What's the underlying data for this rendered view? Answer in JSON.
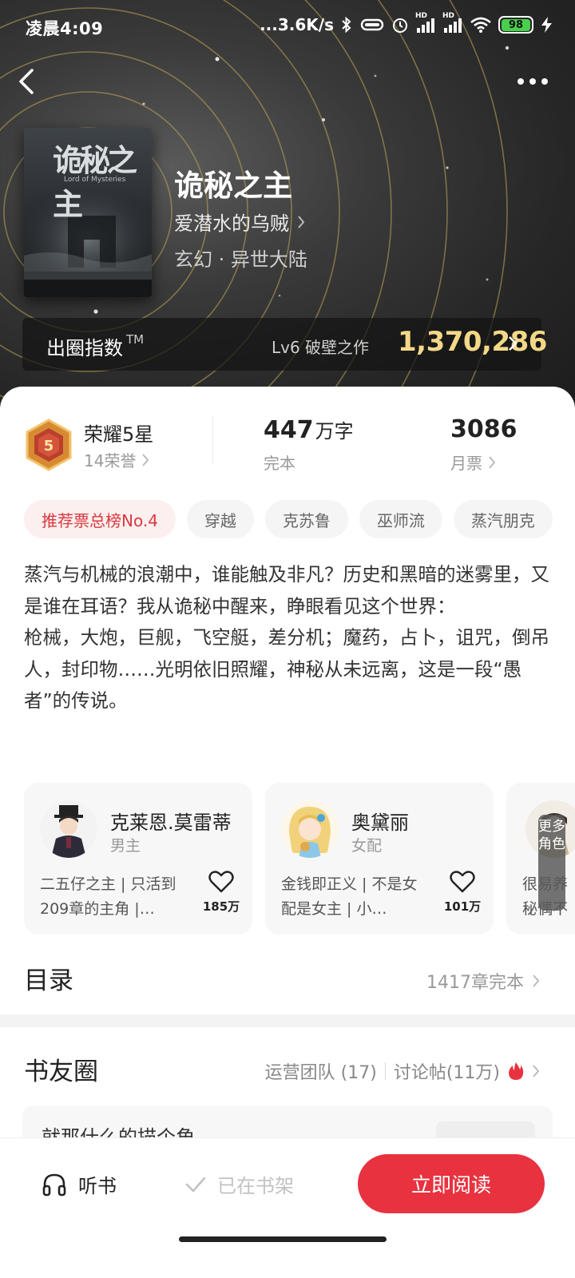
{
  "status_bar": {
    "time": "凌晨4:09",
    "network_speed": "...3.6K/s",
    "signal_label_1": "HD",
    "signal_label_2": "HD",
    "battery": "98"
  },
  "header": {
    "back_icon": "chevron-left-icon",
    "more_icon": "more-dots-icon"
  },
  "book": {
    "cover_title": "诡秘之主",
    "cover_subtitle": "Lord of Mysteries",
    "title": "诡秘之主",
    "author": "爱潜水的乌贼",
    "genre": "玄幻 · 异世大陆"
  },
  "chuquan": {
    "label": "出圈指数",
    "trademark": "TM",
    "level": "Lv6 破壁之作",
    "score": "1,370,286"
  },
  "stats": {
    "honor_title": "荣耀5星",
    "honor_count": "14荣誉",
    "medal_number": "5",
    "words_number": "447",
    "words_unit": "万字",
    "words_status": "完本",
    "votes_number": "3086",
    "votes_label": "月票"
  },
  "tags": [
    "推荐票总榜No.4",
    "穿越",
    "克苏鲁",
    "巫师流",
    "蒸汽朋克"
  ],
  "description": {
    "line1": "蒸汽与机械的浪潮中，谁能触及非凡？历史和黑暗的迷雾里，又是谁在耳语？我从诡秘中醒来，睁眼看见这个世界：",
    "line2": "枪械，大炮，巨舰，飞空艇，差分机；魔药，占卜，诅咒，倒吊人，封印物……光明依旧照耀，神秘从未远离，这是一段“愚者”的传说。"
  },
  "characters": [
    {
      "name": "克莱恩.莫雷蒂",
      "role": "男主",
      "desc": "二五仔之主 | 只活到209章的主角 |…",
      "likes": "185万"
    },
    {
      "name": "奥黛丽",
      "role": "女配",
      "desc": "金钱即正义 | 不是女配是女主 | 小…",
      "likes": "101万"
    }
  ],
  "more_roles": {
    "label": "更多角色",
    "peek_line1": "很易养",
    "peek_line2": "秘偶不"
  },
  "toc": {
    "title": "目录",
    "info": "1417章完本"
  },
  "book_circle": {
    "title": "书友圈",
    "team": "运营团队 (17)",
    "posts": "讨论帖(11万)",
    "post_preview": "就那什么的描个角"
  },
  "bottom_bar": {
    "listen_label": "听书",
    "shelf_label": "已在书架",
    "read_label": "立即阅读"
  },
  "colors": {
    "accent_red": "#e8323f",
    "score_gold": "#f3d887",
    "battery_green": "#47d14b"
  }
}
